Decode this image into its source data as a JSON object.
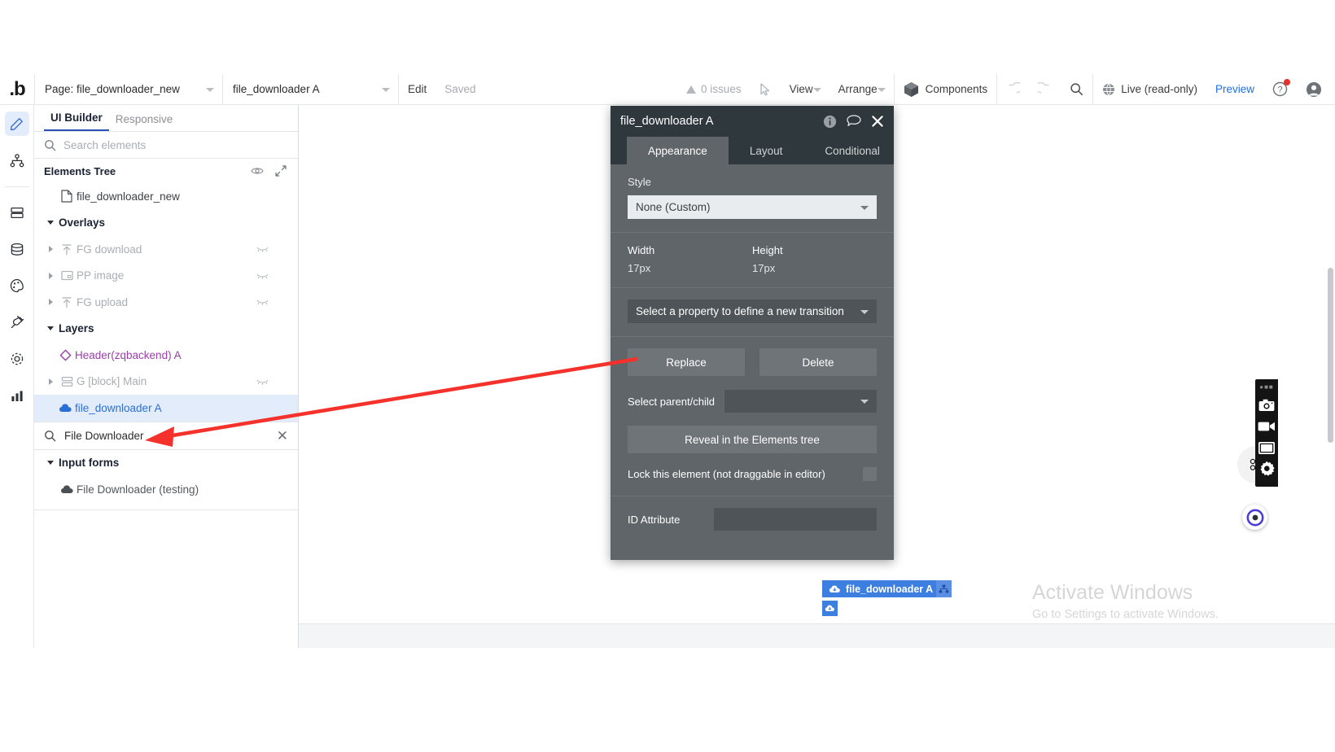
{
  "topbar": {
    "logo": "b-logo-icon",
    "page_select": "Page: file_downloader_new",
    "element_select": "file_downloader A",
    "edit_label": "Edit",
    "saved_label": "Saved",
    "issues_label": "0 issues",
    "cursor_icon": "pointer-icon",
    "view_label": "View",
    "arrange_label": "Arrange",
    "components_label": "Components",
    "undo_icon": "undo-icon",
    "redo_icon": "redo-icon",
    "search_icon": "search-icon",
    "live_label": "Live (read-only)",
    "preview_label": "Preview",
    "help_icon": "help-icon",
    "account_icon": "account-icon"
  },
  "rail": {
    "items": [
      {
        "name": "design",
        "icon": "pencil-icon",
        "active": true
      },
      {
        "name": "workflow",
        "icon": "sitemap-icon",
        "active": false
      },
      {
        "name": "data",
        "icon": "server-icon",
        "active": false
      },
      {
        "name": "database",
        "icon": "database-icon",
        "active": false
      },
      {
        "name": "styles",
        "icon": "palette-icon",
        "active": false
      },
      {
        "name": "plugins",
        "icon": "plug-icon",
        "active": false
      },
      {
        "name": "settings",
        "icon": "gear-icon",
        "active": false
      },
      {
        "name": "logs",
        "icon": "chart-icon",
        "active": false
      }
    ]
  },
  "panel": {
    "tabs": [
      {
        "label": "UI Builder",
        "active": true
      },
      {
        "label": "Responsive",
        "active": false
      }
    ],
    "search_placeholder": "Search elements",
    "search_value": "",
    "tree_title": "Elements Tree",
    "tree_eye_icon": "eye-icon",
    "tree_expand_icon": "expand-icon",
    "tree": [
      {
        "label": "file_downloader_new",
        "icon": "page-icon",
        "indent": 0,
        "twisty": "none",
        "style": "normal",
        "eye": false
      },
      {
        "label": "Overlays",
        "icon": "none",
        "indent": 0,
        "twisty": "down",
        "style": "group",
        "eye": false
      },
      {
        "label": "FG download",
        "icon": "float-icon",
        "indent": 0,
        "twisty": "right",
        "style": "dim",
        "eye": true
      },
      {
        "label": "PP image",
        "icon": "popup-icon",
        "indent": 0,
        "twisty": "right",
        "style": "dim",
        "eye": true
      },
      {
        "label": "FG upload",
        "icon": "float-icon",
        "indent": 0,
        "twisty": "right",
        "style": "dim",
        "eye": true
      },
      {
        "label": "Layers",
        "icon": "none",
        "indent": 0,
        "twisty": "down",
        "style": "group",
        "eye": false
      },
      {
        "label": "Header(zqbackend) A",
        "icon": "diamond-icon",
        "indent": 1,
        "twisty": "none",
        "style": "purple",
        "eye": false
      },
      {
        "label": "G [block] Main",
        "icon": "group-icon",
        "indent": 0,
        "twisty": "right",
        "style": "dim",
        "eye": true
      },
      {
        "label": "file_downloader A",
        "icon": "cloud-download-icon",
        "indent": 1,
        "twisty": "none",
        "style": "blue-selected",
        "eye": false
      }
    ],
    "filter_value": "File Downloader",
    "filter_icon": "search-icon",
    "filter_clear_icon": "close-icon",
    "results": [
      {
        "label": "Input forms",
        "type": "group"
      },
      {
        "label": "File Downloader (testing)",
        "type": "item",
        "icon": "cloud-download-icon"
      }
    ]
  },
  "dialog": {
    "title": "file_downloader A",
    "info_icon": "info-icon",
    "comment_icon": "comment-icon",
    "close_icon": "close-icon",
    "tabs": [
      {
        "label": "Appearance",
        "active": true
      },
      {
        "label": "Layout",
        "active": false
      },
      {
        "label": "Conditional",
        "active": false
      }
    ],
    "style_label": "Style",
    "style_value": "None (Custom)",
    "width_label": "Width",
    "width_value": "17px",
    "height_label": "Height",
    "height_value": "17px",
    "transition_value": "Select a property to define a new transition",
    "replace_label": "Replace",
    "delete_label": "Delete",
    "parent_child_label": "Select parent/child",
    "parent_child_value": "",
    "reveal_label": "Reveal in the Elements tree",
    "lock_label": "Lock this element (not draggable in editor)",
    "lock_checked": false,
    "id_attr_label": "ID Attribute",
    "id_attr_value": ""
  },
  "canvas": {
    "selection_badge": "file_downloader A",
    "selection_badge_icon": "cloud-download-icon",
    "selection_extra_icon": "hierarchy-icon",
    "selection_handle_icon": "cloud-download-icon"
  },
  "right_toolbar": {
    "drag_icon": "drag-dots-icon",
    "buttons": [
      {
        "name": "screenshot",
        "icon": "camera-icon"
      },
      {
        "name": "record-video",
        "icon": "video-icon"
      },
      {
        "name": "window-capture",
        "icon": "window-icon"
      },
      {
        "name": "toolbar-settings",
        "icon": "gear-icon"
      }
    ],
    "bubble_icon": "circle-logo-icon"
  },
  "watermark": {
    "line1": "Activate Windows",
    "line2": "Go to Settings to activate Windows."
  },
  "colors": {
    "accent_blue": "#2a6fd6",
    "selection_blue": "#3d7fe0",
    "dialog_bg": "#606569",
    "dialog_header": "#2f383c",
    "annotation_red": "#f4312a",
    "purple": "#9b3fa8"
  }
}
